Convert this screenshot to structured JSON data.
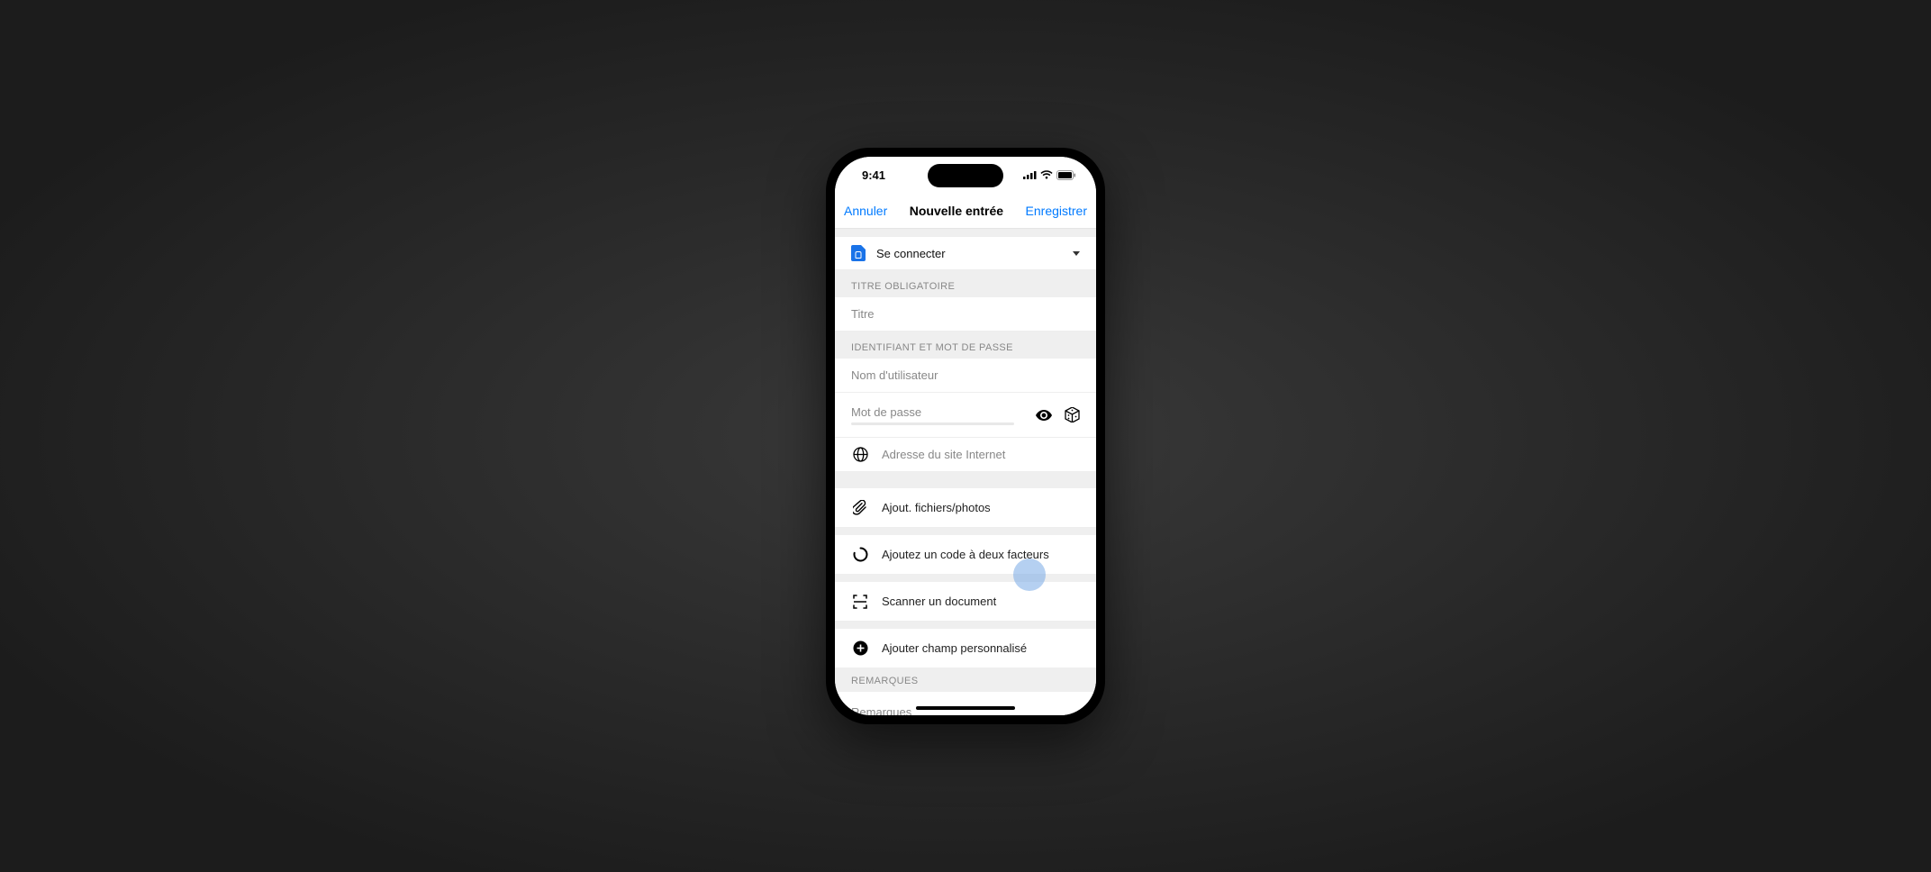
{
  "status": {
    "time": "9:41"
  },
  "nav": {
    "cancel": "Annuler",
    "title": "Nouvelle entrée",
    "save": "Enregistrer"
  },
  "type_selector": {
    "label": "Se connecter"
  },
  "sections": {
    "title_header": "TITRE OBLIGATOIRE",
    "title_placeholder": "Titre",
    "credentials_header": "IDENTIFIANT ET MOT DE PASSE",
    "username_placeholder": "Nom d'utilisateur",
    "password_placeholder": "Mot de passe",
    "website_placeholder": "Adresse du site Internet",
    "attach_label": "Ajout. fichiers/photos",
    "twofa_label": "Ajoutez un code à deux facteurs",
    "scan_label": "Scanner un document",
    "custom_field_label": "Ajouter champ personnalisé",
    "notes_header": "REMARQUES",
    "notes_placeholder": "Remarques"
  }
}
